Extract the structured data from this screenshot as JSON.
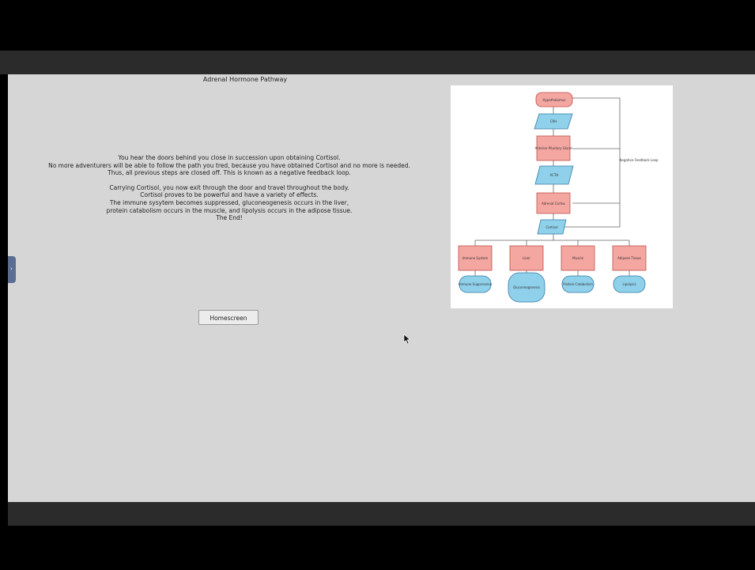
{
  "page": {
    "title": "Adrenal Hormone Pathway",
    "story_lines": [
      "You hear the doors behind you close in succession upon obtaining Cortisol.",
      "No more adventurers will be able to follow the path you tred, because you have obtained Cortisol and no more is needed.",
      "Thus, all previous steps are closed off. This is known as a negative feedback loop."
    ],
    "story_lines_2": [
      "Carrying Cortisol, you now exit through the door and travel throughout the body.",
      "Cortisol proves to be powerful and have a variety of effects.",
      "The immune sysytem becomes suppressed, gluconeogenesis occurs in the liver,",
      "protein catabolism occurs in the muscle, and lipolysis occurs in the adipose tissue.",
      "The End!"
    ],
    "home_button": "Homescreen",
    "side_tab_icon": "arrow-right-icon"
  },
  "diagram": {
    "labels": {
      "top": "Hypothalamus",
      "crh": "CRH",
      "pituitary": "Anterior Pituitary Gland",
      "acth": "ACTH",
      "adrenal": "Adrenal Cortex",
      "cortisol": "Cortisol",
      "feedback": "Negative Feedback Loop",
      "t1": "Immune System",
      "t2": "Liver",
      "t3": "Muscle",
      "t4": "Adipose Tissue",
      "e1": "Immune Suppression",
      "e2": "Gluconeogenesis",
      "e3": "Protein Catabolism",
      "e4": "Lipolysis"
    },
    "colors": {
      "red_fill": "#f4a6a0",
      "red_stroke": "#c0504d",
      "blue_fill": "#8fd0ea",
      "blue_stroke": "#3a7ca5"
    }
  }
}
